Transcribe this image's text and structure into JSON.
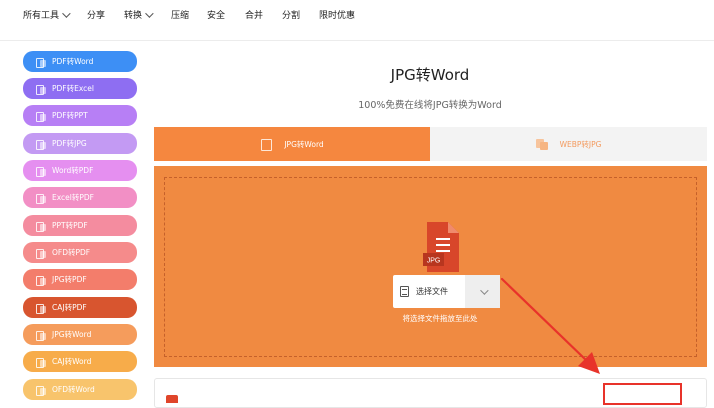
{
  "topnav": {
    "items": [
      {
        "label": "所有工具",
        "dropdown": true
      },
      {
        "label": "分享",
        "dropdown": false
      },
      {
        "label": "转换",
        "dropdown": true
      },
      {
        "label": "压缩",
        "dropdown": false
      },
      {
        "label": "安全",
        "dropdown": false
      },
      {
        "label": "合并",
        "dropdown": false
      },
      {
        "label": "分割",
        "dropdown": false
      },
      {
        "label": "限时优惠",
        "dropdown": false
      }
    ]
  },
  "sidebar": {
    "items": [
      {
        "label": "PDF转Word",
        "color": "#3d8ff5"
      },
      {
        "label": "PDF转Excel",
        "color": "#8e6ef2"
      },
      {
        "label": "PDF转PPT",
        "color": "#b77ff5"
      },
      {
        "label": "PDF转JPG",
        "color": "#c39af3"
      },
      {
        "label": "Word转PDF",
        "color": "#e58ff0"
      },
      {
        "label": "Excel转PDF",
        "color": "#f28fc5"
      },
      {
        "label": "PPT转PDF",
        "color": "#f48c9f"
      },
      {
        "label": "OFD转PDF",
        "color": "#f58b8b"
      },
      {
        "label": "JPG转PDF",
        "color": "#f37d6b"
      },
      {
        "label": "CAJ转PDF",
        "color": "#d8552f"
      },
      {
        "label": "JPG转Word",
        "color": "#f59c5c"
      },
      {
        "label": "CAJ转Word",
        "color": "#f7ac4a"
      },
      {
        "label": "OFD转Word",
        "color": "#f8c46c"
      }
    ]
  },
  "main": {
    "title": "JPG转Word",
    "subtitle": "100%免费在线将JPG转换为Word",
    "tabs": [
      {
        "label": "JPG转Word",
        "active": true
      },
      {
        "label": "WEBP转JPG",
        "active": false
      }
    ],
    "upload": {
      "file_icon_label": "JPG",
      "select_button_label": "选择文件",
      "drop_hint": "将选择文件拖放至此处"
    }
  },
  "colors": {
    "accent_orange": "#f5873f",
    "upload_bg": "#f08a41",
    "annotation_red": "#e8332a"
  }
}
